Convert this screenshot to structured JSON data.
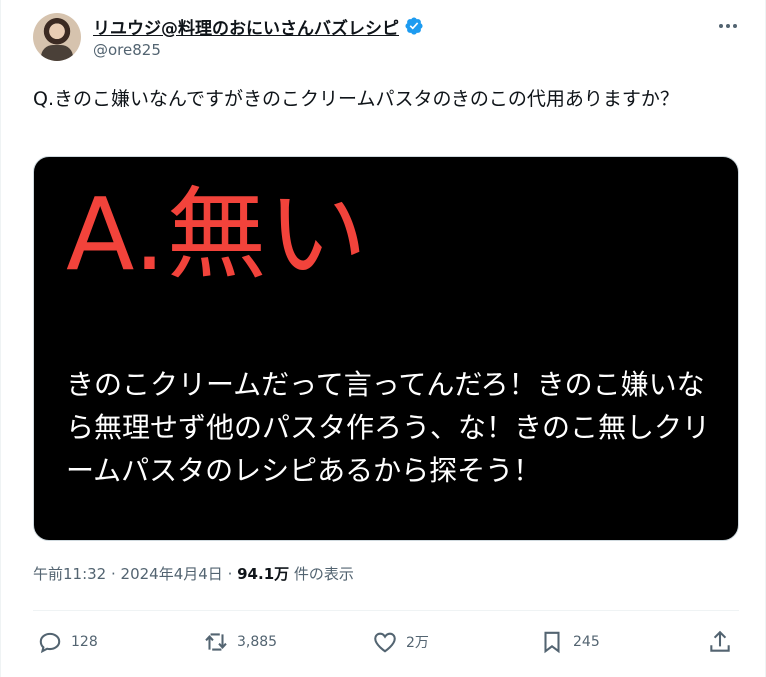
{
  "author": {
    "name": "リユウジ@料理のおにいさんバズレシピ",
    "handle": "@ore825",
    "verified_color": "#1d9bf0"
  },
  "tweet": {
    "text": "Q.きのこ嫌いなんですがきのこクリームパスタのきのこの代用ありますか？"
  },
  "media": {
    "title": "A.無い",
    "title_color": "#f2433b",
    "body": "きのこクリームだって言ってんだろ！きのこ嫌いなら無理せず他のパスタ作ろう、な！きのこ無しクリームパスタのレシピあるから探そう！"
  },
  "meta": {
    "time": "午前11:32",
    "sep1": " · ",
    "date": "2024年4月4日",
    "sep2": " · ",
    "views": "94.1万",
    "views_label": " 件の表示"
  },
  "actions": {
    "reply": {
      "icon": "reply-icon",
      "count": "128"
    },
    "retweet": {
      "icon": "retweet-icon",
      "count": "3,885"
    },
    "like": {
      "icon": "heart-icon",
      "count": "2万"
    },
    "bookmark": {
      "icon": "bookmark-icon",
      "count": "245"
    },
    "share": {
      "icon": "share-icon"
    }
  }
}
